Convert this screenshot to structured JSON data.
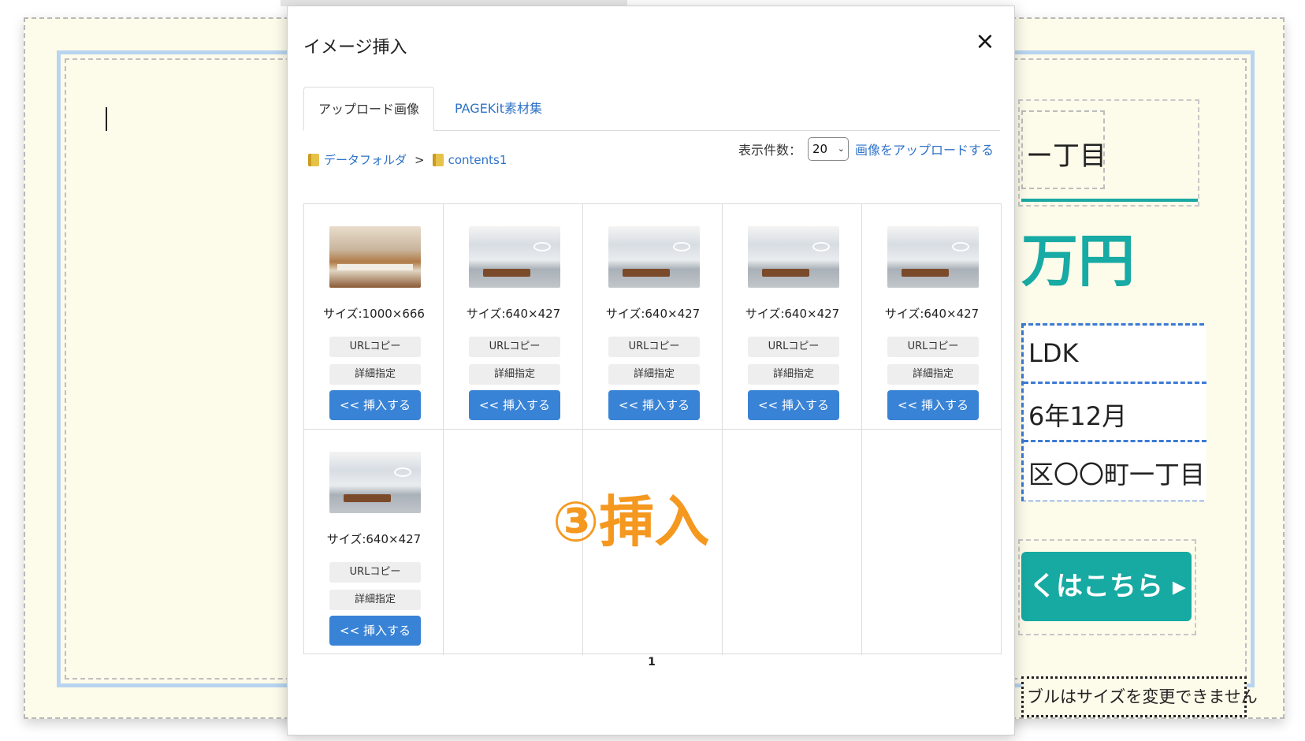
{
  "background": {
    "address_fragment": "ー丁目",
    "price_fragment": "万円",
    "table_rows": [
      "LDK",
      "6年12月",
      "区〇〇町一丁目"
    ],
    "cta_label": "くはこちら ▸",
    "note": "ブルはサイズを変更できません"
  },
  "modal": {
    "title": "イメージ挿入",
    "close_icon": "×",
    "tabs": [
      {
        "label": "アップロード画像",
        "active": true
      },
      {
        "label": "PAGEKit素材集",
        "active": false
      }
    ],
    "breadcrumb": {
      "root": "データフォルダ",
      "separator": ">",
      "current": "contents1"
    },
    "per_page_label": "表示件数：",
    "per_page_value": "20",
    "upload_link": "画像をアップロードする",
    "images": [
      {
        "size": "サイズ:1000×666",
        "thumb": "kitchen-photo"
      },
      {
        "size": "サイズ:640×427",
        "thumb": "office-photo"
      },
      {
        "size": "サイズ:640×427",
        "thumb": "office-photo"
      },
      {
        "size": "サイズ:640×427",
        "thumb": "office-photo"
      },
      {
        "size": "サイズ:640×427",
        "thumb": "office-photo"
      },
      {
        "size": "サイズ:640×427",
        "thumb": "office-photo"
      }
    ],
    "buttons": {
      "url_copy": "URLコピー",
      "detail": "詳細指定",
      "insert": "<< 挿入する"
    },
    "annotation": "③挿入",
    "page": "1"
  },
  "colors": {
    "accent": "#3983d6",
    "link": "#2f73c7",
    "annotation": "#f5981f",
    "teal": "#16aaa3"
  }
}
